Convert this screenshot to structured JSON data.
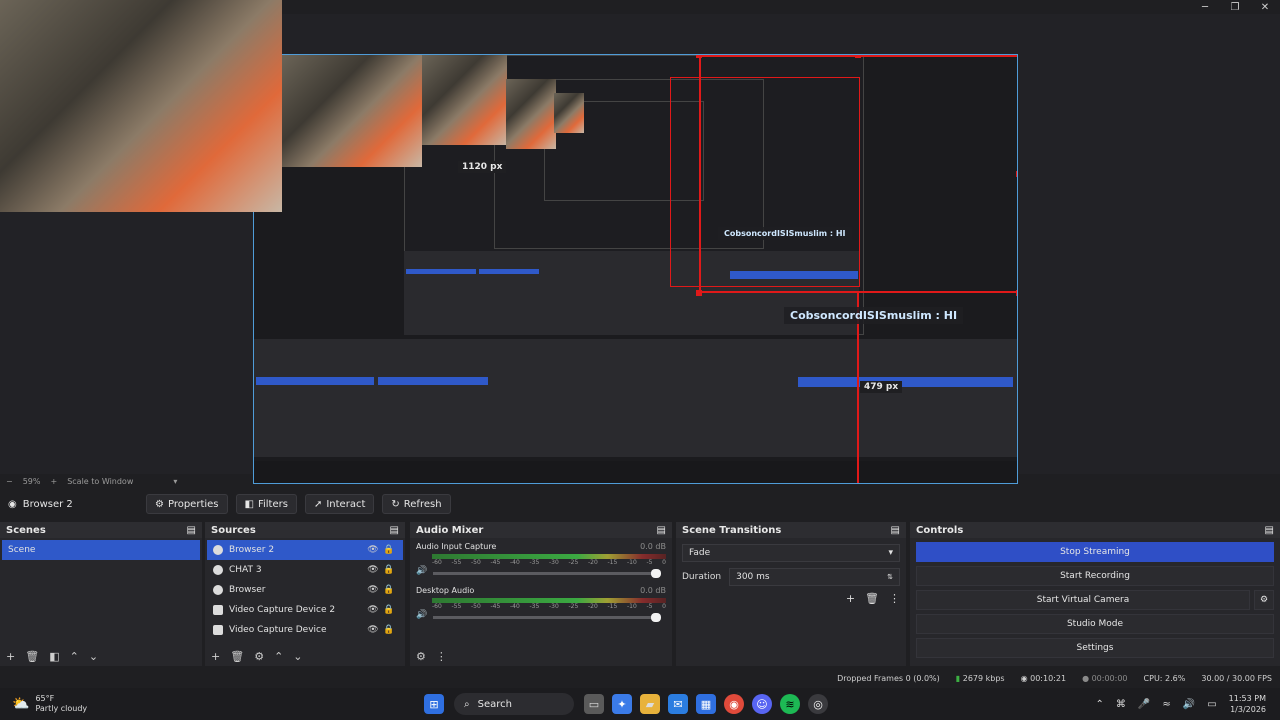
{
  "window": {
    "minimize": "─",
    "maximize": "❐",
    "close": "✕"
  },
  "preview": {
    "chat_message_small": "CobsoncordISISmuslim : HI",
    "chat_message_large": "CobsoncordISISmuslim : HI",
    "width_label": "1120 px",
    "height_label": "479 px"
  },
  "zoom_row": {
    "zoom": "59%",
    "scale_mode": "Scale to Window"
  },
  "toolbar": {
    "selected_source": "Browser 2",
    "properties": "Properties",
    "filters": "Filters",
    "interact": "Interact",
    "refresh": "Refresh"
  },
  "scenes": {
    "title": "Scenes",
    "items": [
      "Scene"
    ]
  },
  "sources": {
    "title": "Sources",
    "items": [
      {
        "name": "Browser 2",
        "icon": "globe-icon"
      },
      {
        "name": "CHAT 3",
        "icon": "globe-icon"
      },
      {
        "name": "Browser",
        "icon": "globe-icon"
      },
      {
        "name": "Video Capture Device 2",
        "icon": "camera-icon"
      },
      {
        "name": "Video Capture Device",
        "icon": "camera-icon"
      }
    ]
  },
  "audio_mixer": {
    "title": "Audio Mixer",
    "channels": [
      {
        "name": "Audio Input Capture",
        "db": "0.0 dB"
      },
      {
        "name": "Desktop Audio",
        "db": "0.0 dB"
      }
    ],
    "ticks": [
      "-60",
      "-55",
      "-50",
      "-45",
      "-40",
      "-35",
      "-30",
      "-25",
      "-20",
      "-15",
      "-10",
      "-5",
      "0"
    ]
  },
  "scene_transitions": {
    "title": "Scene Transitions",
    "transition": "Fade",
    "duration_label": "Duration",
    "duration_value": "300 ms"
  },
  "controls": {
    "title": "Controls",
    "stop_streaming": "Stop Streaming",
    "start_recording": "Start Recording",
    "start_virtual_camera": "Start Virtual Camera",
    "studio_mode": "Studio Mode",
    "settings": "Settings"
  },
  "statusbar": {
    "dropped_frames": "Dropped Frames 0 (0.0%)",
    "bitrate": "2679 kbps",
    "stream_time": "00:10:21",
    "record_time": "00:00:00",
    "cpu": "CPU: 2.6%",
    "fps": "30.00 / 30.00 FPS"
  },
  "taskbar": {
    "weather_temp": "65°F",
    "weather_desc": "Partly cloudy",
    "search_placeholder": "Search",
    "time": "11:53 PM",
    "date": "1/3/2026"
  },
  "colors": {
    "accent": "#2f59c9",
    "selection_red": "#e01919",
    "canvas_border": "#4f9cd8"
  }
}
